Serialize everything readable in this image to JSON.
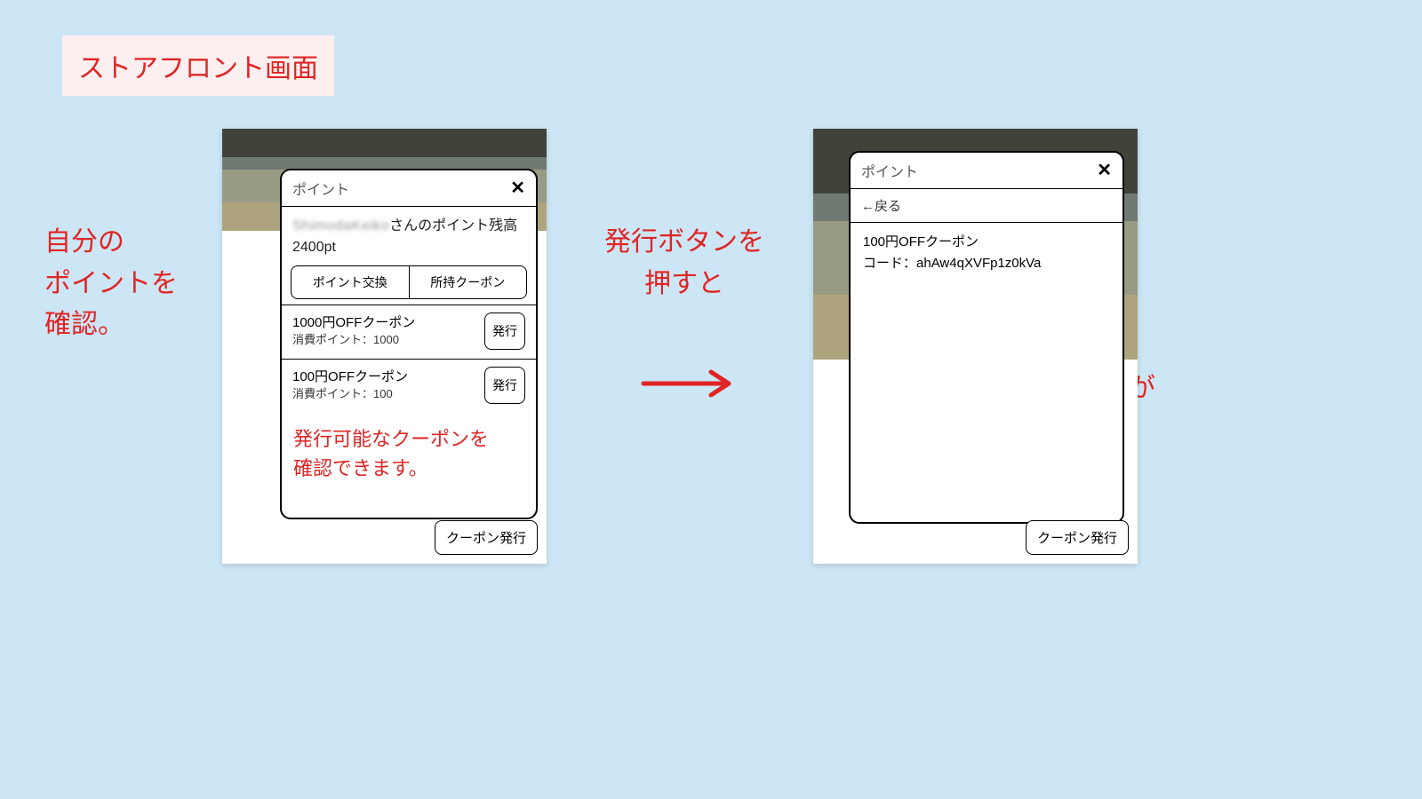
{
  "title": "ストアフロント画面",
  "annotations": {
    "left": "自分の\nポイントを\n確認。",
    "mid": "発行ボタンを\n押すと",
    "inside_left": "発行可能なクーポンを\n確認できます。",
    "right": "クーポンコードが\n発行されます。"
  },
  "dialog_left": {
    "title": "ポイント",
    "balance_user_blurred": "ShimodaKeiko",
    "balance_suffix": "さんのポイント残高",
    "balance_value": "2400pt",
    "tabs": {
      "exchange": "ポイント交換",
      "owned": "所持クーポン"
    },
    "coupons": [
      {
        "name": "1000円OFFクーポン",
        "cost": "消費ポイント：1000",
        "button": "発行"
      },
      {
        "name": "100円OFFクーポン",
        "cost": "消費ポイント：100",
        "button": "発行"
      }
    ],
    "footer_button": "クーポン発行"
  },
  "dialog_right": {
    "title": "ポイント",
    "back": "←戻る",
    "coupon_name": "100円OFFクーポン",
    "code_label": "コード：",
    "code_value": "ahAw4qXVFp1z0kVa",
    "footer_button": "クーポン発行"
  }
}
